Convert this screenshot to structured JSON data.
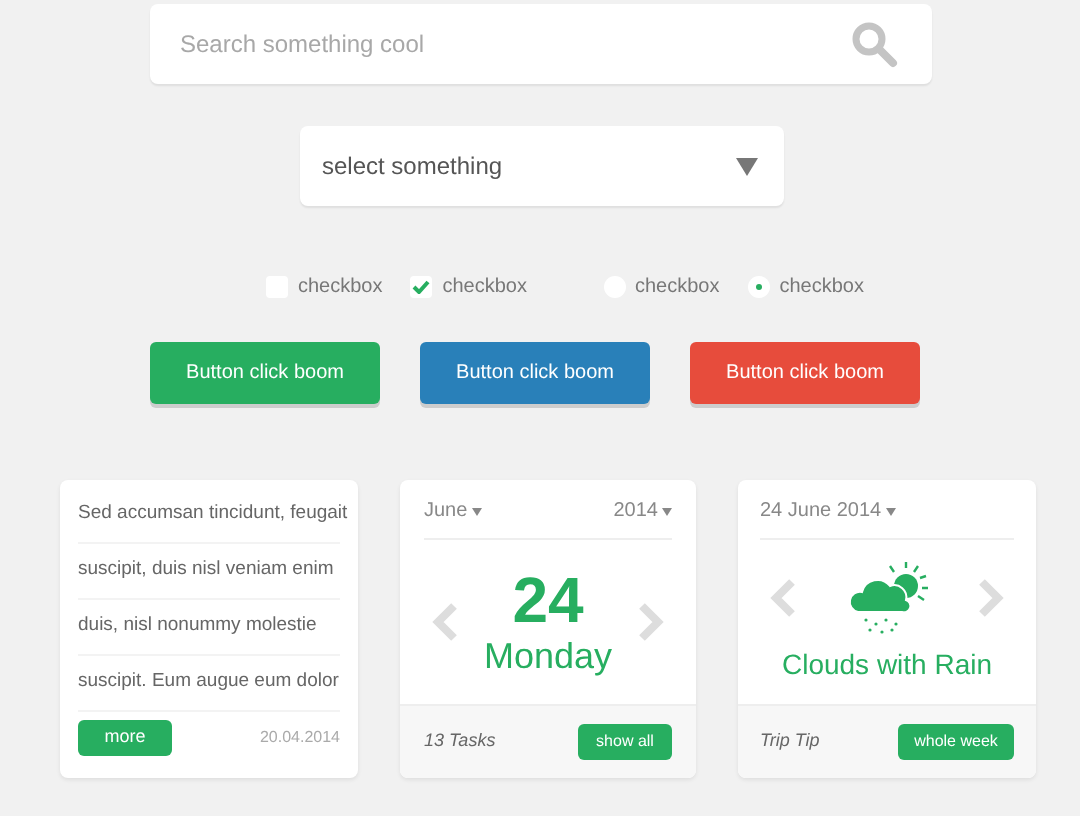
{
  "search": {
    "placeholder": "Search something cool"
  },
  "select": {
    "value": "select something"
  },
  "options": [
    {
      "kind": "checkbox",
      "label": "checkbox",
      "checked": false
    },
    {
      "kind": "checkbox",
      "label": "checkbox",
      "checked": true
    },
    {
      "kind": "radio",
      "label": "checkbox",
      "checked": false
    },
    {
      "kind": "radio",
      "label": "checkbox",
      "checked": true
    }
  ],
  "buttons": [
    {
      "label": "Button click boom",
      "color": "#27ae60"
    },
    {
      "label": "Button click boom",
      "color": "#2980b9"
    },
    {
      "label": "Button click boom",
      "color": "#e74c3c"
    }
  ],
  "text_card": {
    "lines": [
      "Sed accumsan tincidunt, feugait",
      "suscipit, duis nisl veniam enim",
      "duis, nisl nonummy molestie",
      "suscipit. Eum augue eum dolor"
    ],
    "button": "more",
    "date": "20.04.2014"
  },
  "calendar_card": {
    "month": "June",
    "year": "2014",
    "day": "24",
    "weekday": "Monday",
    "footer": "13 Tasks",
    "button": "show all"
  },
  "weather_card": {
    "date": "24 June 2014",
    "condition": "Clouds with Rain",
    "footer": "Trip Tip",
    "button": "whole week"
  }
}
